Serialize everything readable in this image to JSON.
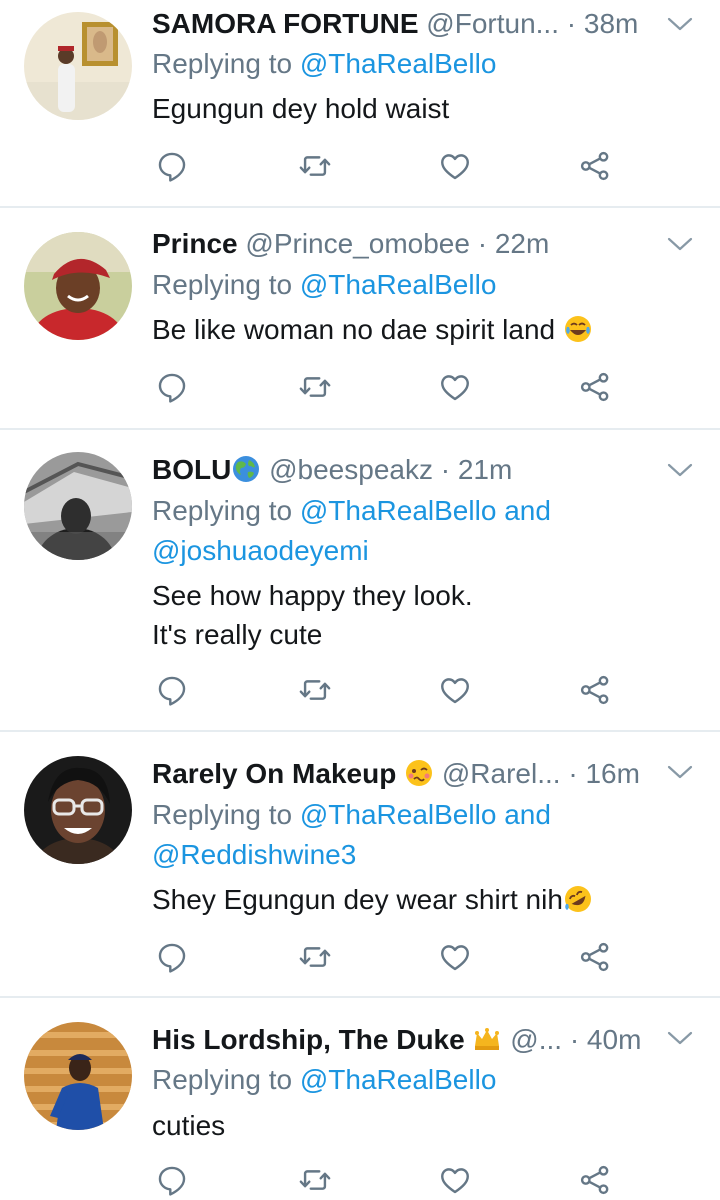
{
  "colors": {
    "accent": "#1b95e0",
    "muted": "#657786",
    "text": "#14171a",
    "divider": "#e6ecf0"
  },
  "tweets": [
    {
      "name": "SAMORA FORTUNE",
      "handle": "@Fortun...",
      "dot": "·",
      "time": "38m",
      "replying_prefix": "Replying to",
      "replying_to": [
        "@ThaRealBello"
      ],
      "text_lines": [
        "Egungun dey hold waist"
      ]
    },
    {
      "name": "Prince",
      "handle": "@Prince_omobee",
      "dot": "·",
      "time": "22m",
      "replying_prefix": "Replying to",
      "replying_to": [
        "@ThaRealBello"
      ],
      "text_lines": [
        "Be like woman no dae spirit land"
      ],
      "text_emoji": "face-with-tears-of-joy"
    },
    {
      "name": "BOLU",
      "name_emoji": "globe-icon",
      "handle": "@beespeakz",
      "dot": "·",
      "time": "21m",
      "replying_prefix": "Replying to",
      "replying_to": [
        "@ThaRealBello",
        "@joshuaodeyemi"
      ],
      "replying_and": "and",
      "text_lines": [
        "See how happy they look.",
        "It's really cute"
      ]
    },
    {
      "name": "Rarely On Makeup",
      "name_emoji": "woozy-face",
      "handle": "@Rarel...",
      "dot": "·",
      "time": "16m",
      "replying_prefix": "Replying to",
      "replying_to": [
        "@ThaRealBello",
        "@Reddishwine3"
      ],
      "replying_and": "and",
      "text_lines": [
        "Shey Egungun dey wear shirt nih"
      ],
      "text_emoji": "rolling-on-floor-laughing"
    },
    {
      "name": "His Lordship, The Duke",
      "name_emoji": "crown-icon",
      "handle": "@...",
      "dot": "·",
      "time": "40m",
      "replying_prefix": "Replying to",
      "replying_to": [
        "@ThaRealBello"
      ],
      "text_lines": [
        "cuties"
      ]
    }
  ],
  "action_icons": [
    "reply-icon",
    "retweet-icon",
    "like-icon",
    "share-icon"
  ]
}
